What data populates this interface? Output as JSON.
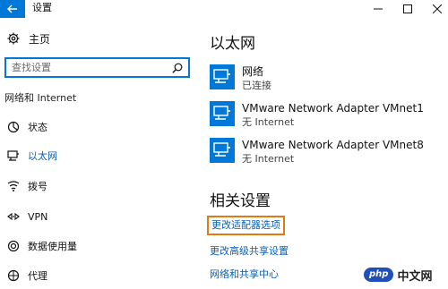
{
  "window": {
    "title": "设置"
  },
  "sidebar": {
    "home_label": "主页",
    "search_placeholder": "查找设置",
    "section_title": "网络和 Internet",
    "items": [
      {
        "label": "状态",
        "icon": "status-icon"
      },
      {
        "label": "以太网",
        "icon": "ethernet-icon",
        "active": true
      },
      {
        "label": "拨号",
        "icon": "dialup-icon"
      },
      {
        "label": "VPN",
        "icon": "vpn-icon"
      },
      {
        "label": "数据使用量",
        "icon": "data-usage-icon"
      },
      {
        "label": "代理",
        "icon": "proxy-icon"
      }
    ]
  },
  "main": {
    "title": "以太网",
    "networks": [
      {
        "name": "网络",
        "status": "已连接"
      },
      {
        "name": "VMware Network Adapter VMnet1",
        "status": "无 Internet"
      },
      {
        "name": "VMware Network Adapter VMnet8",
        "status": "无 Internet"
      }
    ],
    "related_title": "相关设置",
    "related_links": [
      "更改适配器选项",
      "更改高级共享设置",
      "网络和共享中心"
    ]
  },
  "watermark": {
    "badge": "php",
    "text": "中文网"
  },
  "colors": {
    "accent": "#0078d7",
    "link": "#0b5fb0",
    "highlight": "#e07b14"
  }
}
